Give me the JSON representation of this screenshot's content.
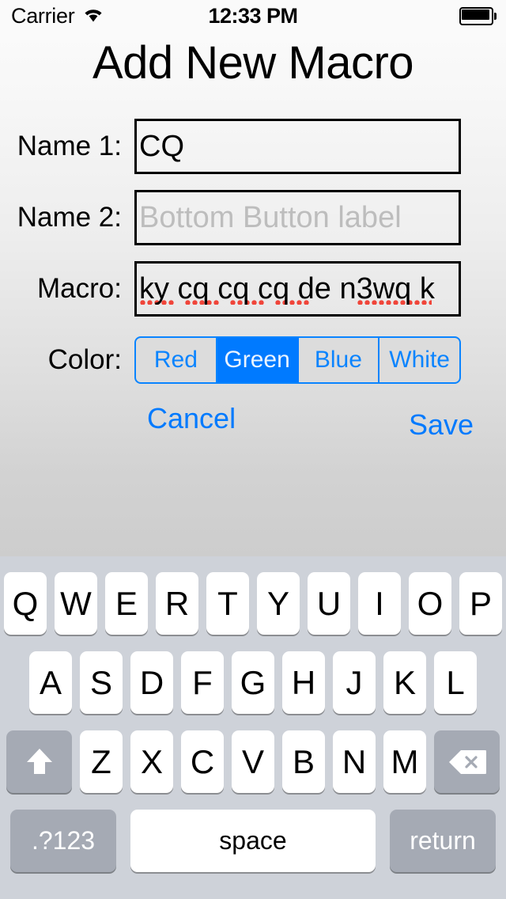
{
  "status_bar": {
    "carrier": "Carrier",
    "wifi_icon": "wifi-icon",
    "time": "12:33 PM",
    "battery_icon": "battery-full-icon"
  },
  "header": {
    "title": "Add New Macro"
  },
  "form": {
    "rows": [
      {
        "label": "Name 1:",
        "value": "CQ",
        "placeholder": "",
        "is_placeholder": false
      },
      {
        "label": "Name 2:",
        "value": "Bottom Button label",
        "placeholder": "Bottom Button label",
        "is_placeholder": true
      },
      {
        "label": "Macro:",
        "value": "ky cq cq cq de n3wq k",
        "placeholder": "",
        "is_placeholder": false
      }
    ],
    "color_label": "Color:",
    "color_options": [
      "Red",
      "Green",
      "Blue",
      "White"
    ],
    "color_selected": "Green",
    "cancel_label": "Cancel",
    "save_label": "Save"
  },
  "colors": {
    "accent_blue": "#007aff",
    "segment_border": "#0a84ff",
    "spell_underline": "#f0453a",
    "placeholder_text": "#bdbdbd",
    "keyboard_bg": "#ced2d9",
    "key_dark": "#a5aab4"
  },
  "keyboard": {
    "row1": [
      "Q",
      "W",
      "E",
      "R",
      "T",
      "Y",
      "U",
      "I",
      "O",
      "P"
    ],
    "row2": [
      "A",
      "S",
      "D",
      "F",
      "G",
      "H",
      "J",
      "K",
      "L"
    ],
    "row3_letters": [
      "Z",
      "X",
      "C",
      "V",
      "B",
      "N",
      "M"
    ],
    "shift_icon": "shift-arrow-icon",
    "delete_icon": "delete-backspace-icon",
    "numeric_label": ".?123",
    "space_label": "space",
    "return_label": "return"
  }
}
